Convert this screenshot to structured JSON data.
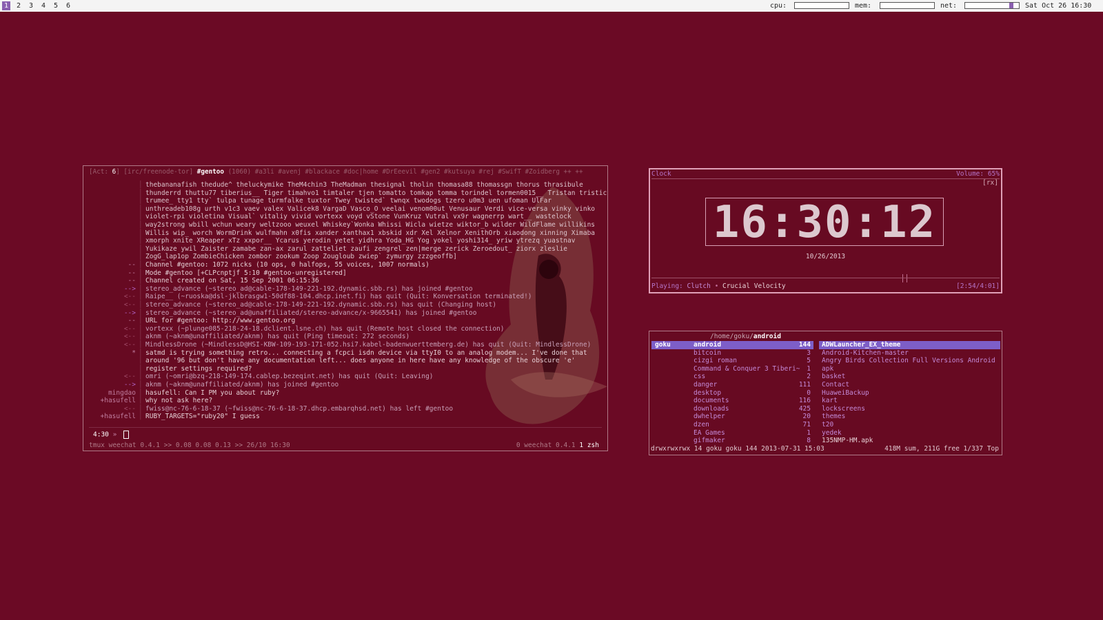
{
  "topbar": {
    "workspaces": [
      "1",
      "2",
      "3",
      "4",
      "5",
      "6"
    ],
    "active_workspace": "1",
    "cpu_label": "cpu:",
    "mem_label": "mem:",
    "net_label": "net:",
    "datetime": "Sat Oct 26 16:30"
  },
  "weechat": {
    "status": {
      "act_prefix": "[Act: ",
      "act_count": "6",
      "act_suffix": "]",
      "network": "[irc/freenode-tor]",
      "channel": "#gentoo",
      "nick_count": "(1060)",
      "others": "#a3li #avenj #blackace #doc|home #DrEeevil #gen2 #kutsuya #rej #SwifT #Zoidberg ++ ++"
    },
    "lines": [
      {
        "prefix": "",
        "msg": "thebananafish thedude^ theluckymike TheM4chin3 TheMadman thesignal tholin thomasa88 thomassgn thorus thrasibule"
      },
      {
        "prefix": "",
        "msg": "thunderrd thuttu77 tiberius__ Tiger timahvo1 timtaler tjen tomatto tomkap tomma torindel tormen0015__ Tristan tristic"
      },
      {
        "prefix": "",
        "msg": "trumee_ tty1 tty` tulpa tunage turmfalke tuxtor Twey twisted` twnqx twodogs tzero u0m3 uen ufoman UlFar"
      },
      {
        "prefix": "",
        "msg": "unthreadeb108g urth v1c3 vaev valex Valicek8 VargaD Vasco_O veelai venom00ut Venusaur Verdi vice-versa vinky vinko"
      },
      {
        "prefix": "",
        "msg": "violet-rpi violetina Visual` vitaliy vivid vortexx voyd vStone VunKruz Vutral vx9r wagnerrp wart__ wastelock"
      },
      {
        "prefix": "",
        "msg": "way2strong wbill wchun weary weltzooo weuxel Whiskey`Wonka Whissi Wicla wietze wiktor_b wilder WildFlame willikins"
      },
      {
        "prefix": "",
        "msg": "Willis wip_ worch WormDrink wulfmahn x0fis xander xanthax1 xbskid xdr Xel Xelnor XenithOrb xiaodong xinning Ximaba"
      },
      {
        "prefix": "",
        "msg": "xmorph xnite XReaper xTz xxpor__ Ycarus yerodin yetet yidhra Yoda_HG Yog yokel yoshi314_ yriw ytrezq yuastnav"
      },
      {
        "prefix": "",
        "msg": "Yukikaze ywil Zaister zamabe zan-ax zarul zatteliet zaufi zengrel zen|merge zerick Zeroedout_ ziorx zleslie"
      },
      {
        "prefix": "",
        "msg": "ZogG_lap1op ZombieChicken zombor zookum Zoop Zougloub zwiep` zymurgy zzzgeoffb]"
      },
      {
        "prefix": "--",
        "msg": "Channel #gentoo: 1072 nicks (10 ops, 0 halfops, 55 voices, 1007 normals)"
      },
      {
        "prefix": "--",
        "msg": "Mode #gentoo [+CLPcnptjf 5:10 #gentoo-unregistered]"
      },
      {
        "prefix": "--",
        "msg": "Channel created on Sat, 15 Sep 2001 06:15:36"
      },
      {
        "prefix": "-->",
        "msg": "stereo_advance (~stereo_ad@cable-178-149-221-192.dynamic.sbb.rs) has joined #gentoo"
      },
      {
        "prefix": "<--",
        "msg": "Raipe__ (~ruoska@dsl-jklbrasgw1-50df88-104.dhcp.inet.fi) has quit (Quit: Konversation terminated!)"
      },
      {
        "prefix": "<--",
        "msg": "stereo_advance (~stereo_ad@cable-178-149-221-192.dynamic.sbb.rs) has quit (Changing host)"
      },
      {
        "prefix": "-->",
        "msg": "stereo_advance (~stereo_ad@unaffiliated/stereo-advance/x-9665541) has joined #gentoo"
      },
      {
        "prefix": "--",
        "msg": "URL for #gentoo: http://www.gentoo.org"
      },
      {
        "prefix": "<--",
        "msg": "vortexx (~plunge085-218-24-18.dclient.lsne.ch) has quit (Remote host closed the connection)"
      },
      {
        "prefix": "<--",
        "msg": "aknm (~aknm@unaffiliated/aknm) has quit (Ping timeout: 272 seconds)"
      },
      {
        "prefix": "<--",
        "msg": "MindlessDrone (~MindlessD@HSI-KBW-109-193-171-052.hsi7.kabel-badenwuerttemberg.de) has quit (Quit: MindlessDrone)"
      },
      {
        "prefix": "*",
        "msg": "satmd is trying something retro... connecting a fcpci isdn device via ttyI0 to an analog modem... I've done that"
      },
      {
        "prefix": "",
        "msg": "around '96 but don't have any documentation left... does anyone in here have any knowledge of the obscure 'e'"
      },
      {
        "prefix": "",
        "msg": "register settings required?"
      },
      {
        "prefix": "<--",
        "msg": "omri (~omri@bzq-218-149-174.cablep.bezeqint.net) has quit (Quit: Leaving)"
      },
      {
        "prefix": "-->",
        "msg": "aknm (~aknm@unaffiliated/aknm) has joined #gentoo"
      },
      {
        "prefix": "mingdao",
        "msg": "hasufell: Can I PM you about ruby?"
      },
      {
        "prefix": "+hasufell",
        "msg": "why not ask here?"
      },
      {
        "prefix": "<--",
        "msg": "fwiss@nc-76-6-18-37 (~fwiss@nc-76-6-18-37.dhcp.embarqhsd.net) has left #gentoo"
      },
      {
        "prefix": "+hasufell",
        "msg": "RUBY_TARGETS=\"ruby20\" I guess"
      }
    ],
    "input_time": "4:30",
    "input_prompt": "»",
    "tmux_left": "tmux weechat 0.4.1 >> 0.08 0.08 0.13 >> 26/10 16:30",
    "tmux_right_prefix": "0 weechat 0.4.1",
    "tmux_right_window": "1 zsh"
  },
  "clock": {
    "title": "Clock",
    "volume": "Volume: 65%",
    "rx": "[rx]",
    "time": "16:30:12",
    "date": "10/26/2013",
    "playing_label": "Playing:",
    "artist": "Clutch",
    "separator": "•",
    "song": "Crucial Velocity",
    "elapsed": "[2:54/4:01]"
  },
  "ranger": {
    "path_prefix": "/home/goku/",
    "path_current": "android",
    "parent_dir": "goku",
    "dirs": [
      {
        "name": "android",
        "count": "144"
      },
      {
        "name": "bitcoin",
        "count": "3"
      },
      {
        "name": "cizgi roman",
        "count": "5"
      },
      {
        "name": "Command & Conquer 3 Tiberi~",
        "count": "1"
      },
      {
        "name": "css",
        "count": "2"
      },
      {
        "name": "danger",
        "count": "111"
      },
      {
        "name": "desktop",
        "count": "0"
      },
      {
        "name": "documents",
        "count": "116"
      },
      {
        "name": "downloads",
        "count": "425"
      },
      {
        "name": "dwhelper",
        "count": "20"
      },
      {
        "name": "dzen",
        "count": "71"
      },
      {
        "name": "EA Games",
        "count": "1"
      },
      {
        "name": "gifmaker",
        "count": "8"
      }
    ],
    "preview": [
      {
        "name": "ADWLauncher_EX_theme",
        "type": "dir"
      },
      {
        "name": "Android-Kitchen-master",
        "type": "dir"
      },
      {
        "name": "Angry Birds Collection Full Versions Android",
        "type": "dir"
      },
      {
        "name": "apk",
        "type": "dir"
      },
      {
        "name": "basket",
        "type": "dir"
      },
      {
        "name": "Contact",
        "type": "dir"
      },
      {
        "name": "HuaweiBackup",
        "type": "dir"
      },
      {
        "name": "kart",
        "type": "dir"
      },
      {
        "name": "lockscreens",
        "type": "dir"
      },
      {
        "name": "themes",
        "type": "dir"
      },
      {
        "name": "t20",
        "type": "dir"
      },
      {
        "name": "yedek",
        "type": "dir"
      },
      {
        "name": "135NMP-HM.apk",
        "type": "file"
      }
    ],
    "footer_left": "drwxrwxrwx 14 goku goku 144 2013-07-31 15:03",
    "footer_right": "418M sum, 211G free  1/337  Top"
  }
}
